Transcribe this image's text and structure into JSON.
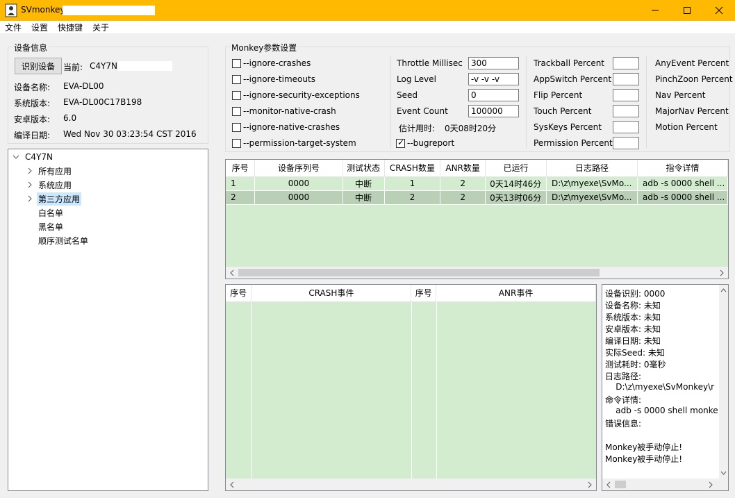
{
  "window": {
    "title": "SVmonkey",
    "colors": {
      "titlebar": "#ffb900",
      "grid_row": "#d3ecd0",
      "grid_row_selected": "#b9d0b6",
      "tree_selected": "#cce8ff"
    }
  },
  "menu": [
    "文件",
    "设置",
    "快捷键",
    "关于"
  ],
  "device_info": {
    "group_title": "设备信息",
    "identify_button": "识别设备",
    "current_label": "当前:",
    "current_value": "C4Y7N",
    "rows": [
      {
        "label": "设备名称:",
        "value": "EVA-DL00"
      },
      {
        "label": "系统版本:",
        "value": "EVA-DL00C17B198"
      },
      {
        "label": "安卓版本:",
        "value": "6.0"
      },
      {
        "label": "编译日期:",
        "value": "Wed Nov 30 03:23:54 CST 2016"
      }
    ]
  },
  "tree": {
    "root": "C4Y7N",
    "items": [
      {
        "label": "所有应用",
        "expandable": true
      },
      {
        "label": "系统应用",
        "expandable": true
      },
      {
        "label": "第三方应用",
        "expandable": true,
        "selected": true
      },
      {
        "label": "白名单",
        "expandable": false
      },
      {
        "label": "黑名单",
        "expandable": false
      },
      {
        "label": "顺序测试名单",
        "expandable": false
      }
    ]
  },
  "monkey": {
    "group_title": "Monkey参数设置",
    "options": [
      {
        "label": "--ignore-crashes",
        "checked": false
      },
      {
        "label": "--ignore-timeouts",
        "checked": false
      },
      {
        "label": "--ignore-security-exceptions",
        "checked": false
      },
      {
        "label": "--monitor-native-crash",
        "checked": false
      },
      {
        "label": "--ignore-native-crashes",
        "checked": false
      },
      {
        "label": "--permission-target-system",
        "checked": false
      }
    ],
    "params": [
      {
        "label": "Throttle Millisec",
        "value": "300"
      },
      {
        "label": "Log Level",
        "value": "-v -v -v"
      },
      {
        "label": "Seed",
        "value": "0"
      },
      {
        "label": "Event Count",
        "value": "100000"
      }
    ],
    "estimate_label": "估计用时:",
    "estimate_value": "0天08时20分",
    "bugreport": {
      "label": "--bugreport",
      "checked": true
    },
    "percents_a": [
      "Trackball Percent",
      "AppSwitch Percent",
      "Flip Percent",
      "Touch Percent",
      "SysKeys Percent",
      "Permission Percent"
    ],
    "percents_b": [
      "AnyEvent Percent",
      "PinchZoon Percent",
      "Nav Percent",
      "MajorNav Percent",
      "Motion Percent"
    ]
  },
  "task_table": {
    "headers": [
      "序号",
      "设备序列号",
      "测试状态",
      "CRASH数量",
      "ANR数量",
      "已运行",
      "日志路径",
      "指令详情"
    ],
    "rows": [
      [
        "1",
        "0000",
        "中断",
        "1",
        "2",
        "0天14时46分",
        "D:\\z\\myexe\\SvMo...",
        "adb -s 0000 shell ..."
      ],
      [
        "2",
        "0000",
        "中断",
        "2",
        "2",
        "0天13时06分",
        "D:\\z\\myexe\\SvMo...",
        "adb -s 0000 shell ..."
      ]
    ],
    "selected_row": 1
  },
  "event_table": {
    "headers": [
      "序号",
      "CRASH事件",
      "序号",
      "ANR事件"
    ]
  },
  "detail": {
    "lines": [
      "设备识别: 0000",
      "设备名称: 未知",
      "系统版本: 未知",
      "安卓版本: 未知",
      "编译日期: 未知",
      "实际Seed: 未知",
      "测试耗时: 0毫秒",
      "日志路径:",
      "    D:\\z\\myexe\\SvMonkey\\r",
      "命令详情:",
      "    adb -s 0000 shell monke",
      "错误信息:",
      "",
      "Monkey被手动停止!",
      "Monkey被手动停止!"
    ]
  }
}
